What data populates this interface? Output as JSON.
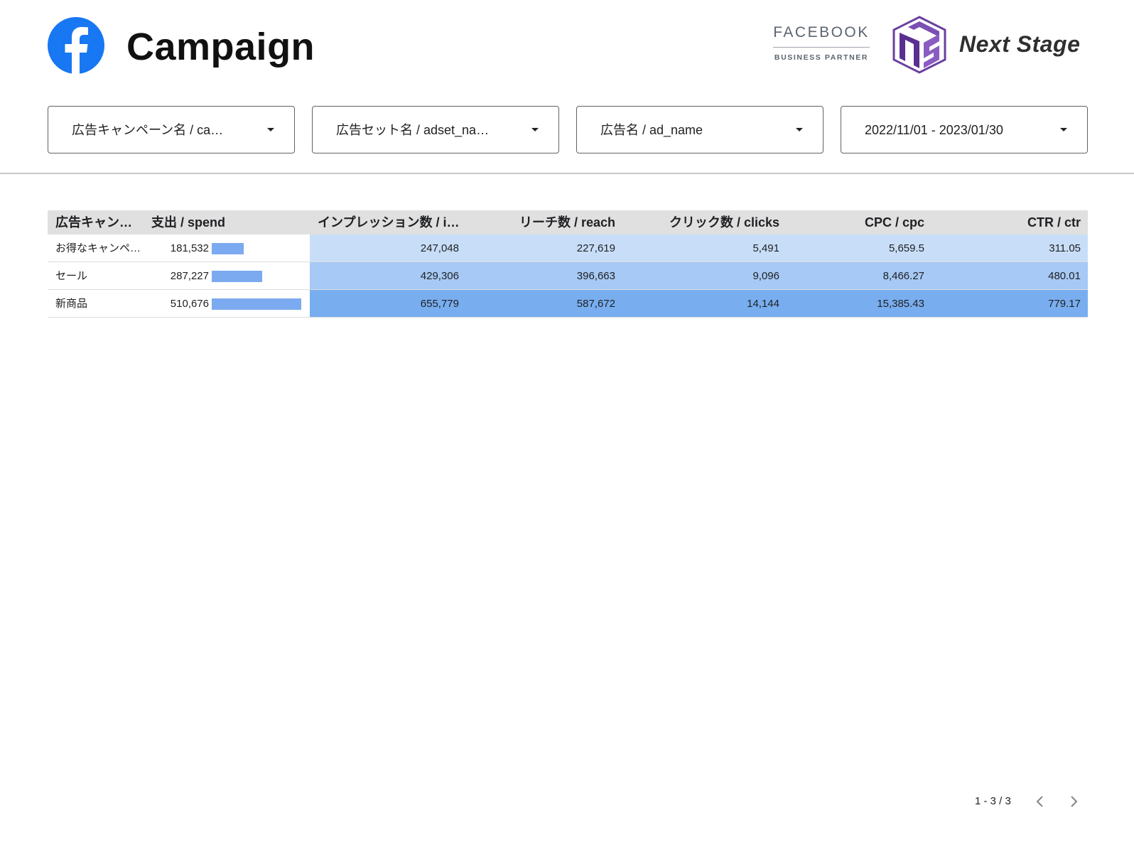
{
  "header": {
    "title": "Campaign",
    "partner_top": "FACEBOOK",
    "partner_bottom": "BUSINESS PARTNER",
    "brand_name": "Next Stage"
  },
  "filters": [
    {
      "label": "広告キャンペーン名 / ca…"
    },
    {
      "label": "広告セット名 / adset_na…"
    },
    {
      "label": "広告名 / ad_name"
    },
    {
      "label": "2022/11/01 - 2023/01/30"
    }
  ],
  "table": {
    "columns": [
      "広告キャン…",
      "支出 / spend",
      "インプレッション数 / i…",
      "リーチ数 / reach",
      "クリック数 / clicks",
      "CPC / cpc",
      "CTR / ctr"
    ],
    "rows": [
      {
        "campaign": "お得なキャンペ…",
        "spend": "181,532",
        "spend_value": 181532,
        "impressions": "247,048",
        "reach": "227,619",
        "clicks": "5,491",
        "cpc": "5,659.5",
        "ctr": "311.05"
      },
      {
        "campaign": "セール",
        "spend": "287,227",
        "spend_value": 287227,
        "impressions": "429,306",
        "reach": "396,663",
        "clicks": "9,096",
        "cpc": "8,466.27",
        "ctr": "480.01"
      },
      {
        "campaign": "新商品",
        "spend": "510,676",
        "spend_value": 510676,
        "impressions": "655,779",
        "reach": "587,672",
        "clicks": "14,144",
        "cpc": "15,385.43",
        "ctr": "779.17"
      }
    ]
  },
  "pagination": {
    "text": "1 - 3 / 3"
  },
  "colors": {
    "facebook_blue": "#1877f2",
    "spend_bar": "#7baaf0",
    "heat_low": "#c8def8",
    "heat_mid": "#a6c9f5",
    "heat_high": "#78aef0",
    "brand_purple": "#6a3fa0"
  },
  "icons": {
    "facebook": "facebook-logo-icon",
    "next_stage": "next-stage-logo-icon",
    "dropdown": "caret-down-icon",
    "prev": "chevron-left-icon",
    "next": "chevron-right-icon"
  }
}
